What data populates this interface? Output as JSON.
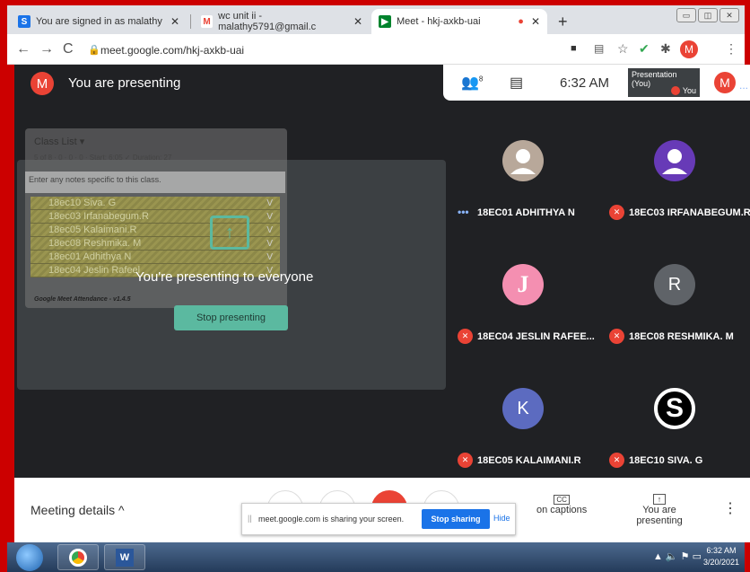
{
  "browser": {
    "tabs": [
      {
        "label": "You are signed in as malathy",
        "fav": "S",
        "fav_color": "#1a73e8"
      },
      {
        "label": "wc unit ii - malathy5791@gmail.c",
        "fav": "M",
        "fav_color": "#ea4335"
      },
      {
        "label": "Meet - hkj-axkb-uai",
        "fav": "▶",
        "fav_color": "#00832d",
        "recording": "●"
      }
    ],
    "tab_close": "✕",
    "new_tab": "+",
    "url": "meet.google.com/hkj-axkb-uai",
    "profile_initial": "M",
    "win_buttons": [
      "▭",
      "◫",
      "✕"
    ]
  },
  "meet": {
    "self_initial": "M",
    "title": "You are presenting",
    "participants_count": "8",
    "clock": "6:32 AM",
    "thumb_label": "Presentation (You)",
    "thumb_you": "You",
    "top_initial": "M",
    "extension": {
      "header": "Class List ▾",
      "stats": "5 of 8 · 0 · 0 · 0 · Start: 6:05 ✓ Duration: 27",
      "notes_placeholder": "Enter any notes specific to this class.",
      "roster": [
        "18ec10 Siva. G",
        "18ec03 Irfanabegum.R",
        "18ec05 Kalaimani.R",
        "18ec08 Reshmika. M",
        "18ec01 Adhithya N",
        "18ec04 Jeslin Rafeel"
      ],
      "roster_v": "V",
      "footer": "Google Meet Attendance - v1.4.5"
    },
    "presenting_message": "You're presenting to everyone",
    "stop_presenting": "Stop presenting"
  },
  "participants": [
    {
      "name": "18EC01 ADHITHYA N",
      "initial": "",
      "color": "#b8a89a",
      "muted": false
    },
    {
      "name": "18EC03 IRFANABEGUM.R",
      "initial": "",
      "color": "#673ab7",
      "muted": true
    },
    {
      "name": "18EC04 JESLIN RAFEE...",
      "initial": "J",
      "color": "#f48fb1",
      "muted": true
    },
    {
      "name": "18EC08 RESHMIKA. M",
      "initial": "R",
      "color": "#5f6368",
      "muted": true
    },
    {
      "name": "18EC05 KALAIMANI.R",
      "initial": "K",
      "color": "#5c6bc0",
      "muted": true
    },
    {
      "name": "18EC10 SIVA. G",
      "initial": "S",
      "color": "#000000",
      "muted": true
    }
  ],
  "bottom": {
    "meeting_details": "Meeting details ^",
    "captions": "on captions",
    "captions_icon": "CC",
    "you_presenting": "You are presenting",
    "present_icon": "↑",
    "more": "⋮"
  },
  "sharebar": {
    "grip": "||",
    "message": "meet.google.com is sharing your screen.",
    "stop": "Stop sharing",
    "hide": "Hide"
  },
  "taskbar": {
    "word_label": "W",
    "tray": "▲ 🔈 ⚑ ▭",
    "time": "6:32 AM",
    "date": "3/20/2021"
  }
}
